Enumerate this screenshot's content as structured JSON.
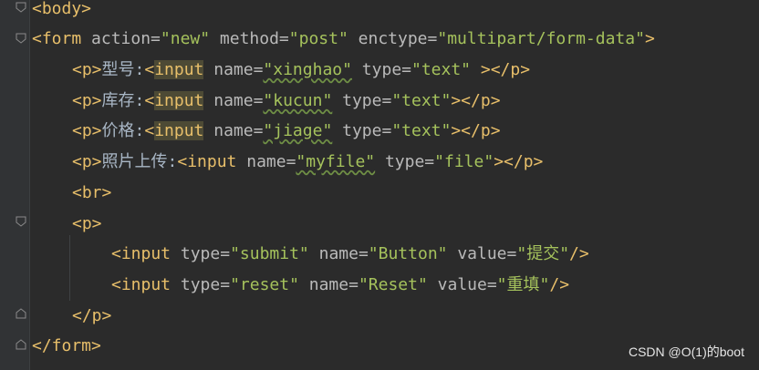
{
  "editor": {
    "lines": [
      [
        "<body>"
      ],
      [
        "<form",
        " action=",
        "\"new\"",
        " method=",
        "\"post\"",
        " enctype=",
        "\"multipart/form-data\"",
        ">"
      ],
      [
        "<p>",
        "型号:",
        "<",
        "input",
        " name=",
        "\"xinghao\"",
        " type=",
        "\"text\"",
        " ></p>"
      ],
      [
        "<p>",
        "库存:",
        "<",
        "input",
        " name=",
        "\"kucun\"",
        " type=",
        "\"text\"",
        "></p>"
      ],
      [
        "<p>",
        "价格:",
        "<",
        "input",
        " name=",
        "\"jiage\"",
        " type=",
        "\"text\"",
        "></p>"
      ],
      [
        "<p>",
        "照片上传:",
        "<input",
        " name=",
        "\"myfile\"",
        " type=",
        "\"file\"",
        "></p>"
      ],
      [
        "<br>"
      ],
      [
        "<p>"
      ],
      [
        "<input",
        " type=",
        "\"submit\"",
        " name=",
        "\"Button\"",
        " value=",
        "\"提交\"",
        "/>"
      ],
      [
        "<input",
        " type=",
        "\"reset\"",
        " name=",
        "\"Reset\"",
        " value=",
        "\"重填\"",
        "/>"
      ],
      [
        "</p>"
      ],
      [
        "</form>"
      ]
    ]
  },
  "watermark": "CSDN @O(1)的boot",
  "colors": {
    "background": "#2b2b2b",
    "tag": "#e8bf6a",
    "attribute": "#bababa",
    "value": "#a5c25c",
    "text": "#a9b7c6"
  }
}
